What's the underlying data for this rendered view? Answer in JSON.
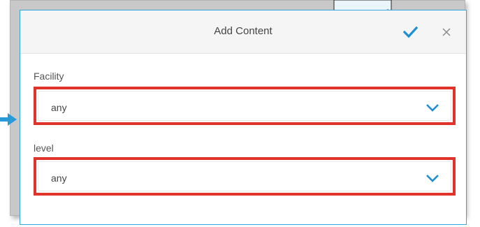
{
  "dialog": {
    "title": "Add Content",
    "confirm_icon": "checkmark-icon",
    "close_icon": "close-icon"
  },
  "fields": {
    "facility": {
      "label": "Facility",
      "value": "any",
      "icon": "chevron-down-icon"
    },
    "level": {
      "label": "level",
      "value": "any",
      "icon": "chevron-down-icon"
    }
  },
  "colors": {
    "accent": "#1e8fd0",
    "dialog_border": "#35a8e0",
    "highlight": "#e0342b",
    "header_bg": "#f5f5f5"
  }
}
